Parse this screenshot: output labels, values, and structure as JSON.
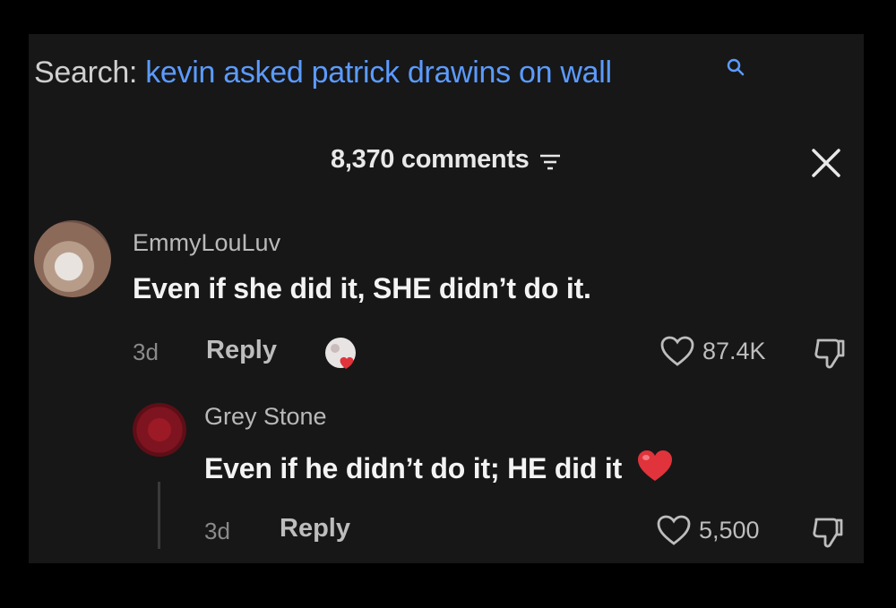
{
  "search": {
    "label": "Search:",
    "query": "kevin asked patrick drawins on wall"
  },
  "comments_header": {
    "count_text": "8,370 comments"
  },
  "comments": [
    {
      "username": "EmmyLouLuv",
      "text": "Even if she did it, SHE didn’t do it.",
      "time": "3d",
      "reply_label": "Reply",
      "likes": "87.4K"
    },
    {
      "username": "Grey Stone",
      "text": "Even if he didn’t do it; HE did it",
      "time": "3d",
      "reply_label": "Reply",
      "likes": "5,500"
    }
  ],
  "colors": {
    "background": "#000000",
    "panel": "#171717",
    "search_query": "#5b9bff",
    "heart_emoji": "#e0333b"
  },
  "icons": [
    "search-icon",
    "filter-icon",
    "close-icon",
    "heart-outline-icon",
    "dislike-icon",
    "heart-emoji-icon",
    "creator-liked-icon"
  ]
}
